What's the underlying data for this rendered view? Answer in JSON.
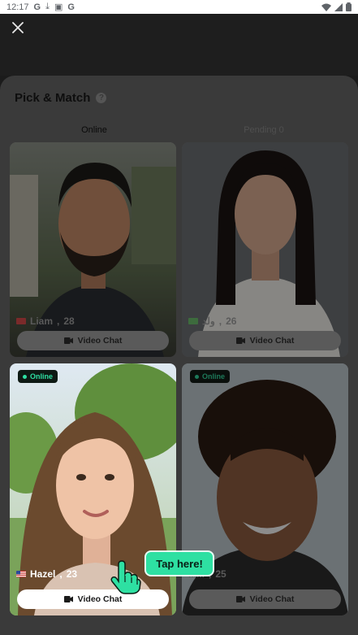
{
  "status_bar": {
    "time": "12:17",
    "icons": [
      "google-g-icon",
      "download-icon",
      "image-icon",
      "google-g-icon"
    ],
    "right_icons": [
      "wifi-icon",
      "signal-icon",
      "battery-icon"
    ]
  },
  "sheet": {
    "title": "Pick & Match",
    "tabs": [
      {
        "label": "Online",
        "active": true
      },
      {
        "label": "Pending 0",
        "active": false
      }
    ]
  },
  "cards": [
    {
      "name": "Liam",
      "age": "28",
      "flag": "turkey-flag-icon",
      "button_label": "Video Chat",
      "online_badge": ""
    },
    {
      "name": "ولد",
      "age": "26",
      "flag": "kuwait-flag-icon",
      "button_label": "Video Chat",
      "online_badge": ""
    },
    {
      "name": "Hazel",
      "age": "23",
      "flag": "us-flag-icon",
      "button_label": "Video Chat",
      "online_badge": "Online"
    },
    {
      "name": "...ill",
      "age": "25",
      "flag": "",
      "button_label": "Video Chat",
      "online_badge": "Online"
    }
  ],
  "tooltip": {
    "label": "Tap here!"
  },
  "colors": {
    "accent": "#2ee0a2",
    "badge_dot": "#2ee0a2"
  }
}
